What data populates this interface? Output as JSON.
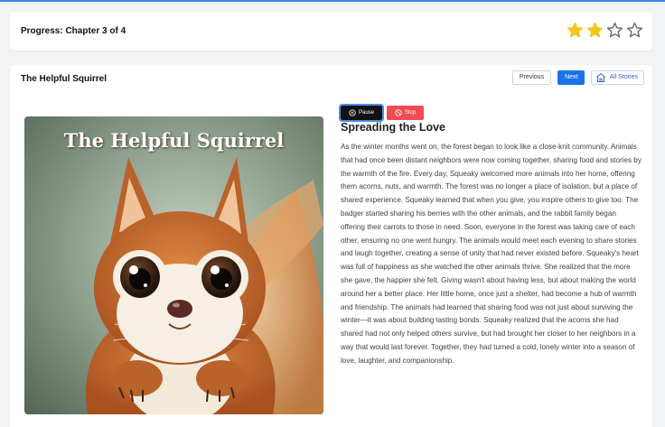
{
  "progress": {
    "label": "Progress: Chapter 3 of 4"
  },
  "rating": {
    "value": 2,
    "max": 5,
    "filled_color": "#f5c518",
    "empty_color": "#6b6b6b"
  },
  "story": {
    "title": "The Helpful Squirrel",
    "illustration_title": "The Helpful Squirrel"
  },
  "nav": {
    "previous_label": "Previous",
    "next_label": "Next",
    "all_stories_label": "All Stories",
    "all_stories_icon": "home-icon"
  },
  "audio": {
    "pause_label": "Pause",
    "pause_icon": "pause-icon",
    "stop_label": "Stop",
    "stop_icon": "stop-icon"
  },
  "chapter": {
    "heading": "Spreading the Love",
    "text": "As the winter months went on, the forest began to look like a close-knit community. Animals that had once been distant neighbors were now coming together, sharing food and stories by the warmth of the fire. Every day, Squeaky welcomed more animals into her home, offering them acorns, nuts, and warmth. The forest was no longer a place of isolation, but a place of shared experience. Squeaky learned that when you give, you inspire others to give too. The badger started sharing his berries with the other animals, and the rabbit family began offering their carrots to those in need. Soon, everyone in the forest was taking care of each other, ensuring no one went hungry. The animals would meet each evening to share stories and laugh together, creating a sense of unity that had never existed before. Squeaky's heart was full of happiness as she watched the other animals thrive. She realized that the more she gave, the happier she felt. Giving wasn't about having less, but about making the world around her a better place. Her little home, once just a shelter, had become a hub of warmth and friendship. The animals had learned that sharing food was not just about surviving the winter—it was about building lasting bonds. Squeaky realized that the acorns she had shared had not only helped others survive, but had brought her closer to her neighbors in a way that would last forever. Together, they had turned a cold, lonely winter into a season of love, laughter, and companionship."
  },
  "colors": {
    "accent": "#1a73e8",
    "stop": "#ef4b55",
    "top_line": "#3b82f6"
  }
}
